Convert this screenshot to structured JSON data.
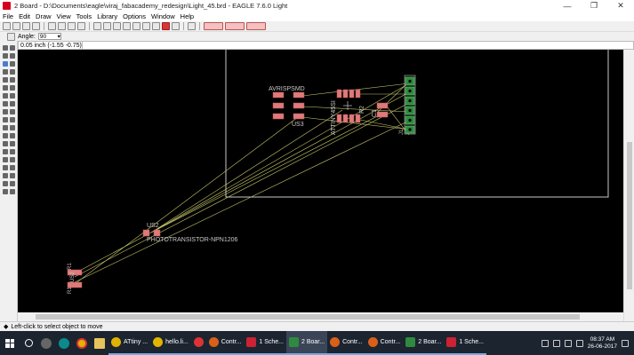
{
  "window": {
    "title": "2 Board - D:\\Documents\\eagle\\viraj_fabacademy_redesign\\Light_45.brd - EAGLE 7.6.0 Light",
    "minimize": "—",
    "maximize": "❐",
    "close": "✕"
  },
  "menu": {
    "items": [
      "File",
      "Edit",
      "Draw",
      "View",
      "Tools",
      "Library",
      "Options",
      "Window",
      "Help"
    ]
  },
  "params": {
    "angle_label": "Angle:",
    "angle_value": "90"
  },
  "coord": {
    "readout": "0.05 inch (-1.55 -0.75)"
  },
  "board": {
    "labels": {
      "avrispsmd": "AVRISPSMD",
      "us3": "US3",
      "attiny": "ATTINY45SI",
      "us2_top": "US2",
      "us2": "US2",
      "phototransistor": "PHOTOTRANSISTOR-NPN1206",
      "r1_top": "R1",
      "r1_bottom": "R1",
      "c1": "C1",
      "j1": "J1",
      "r2": "R2"
    },
    "colors": {
      "background": "#000000",
      "outline": "#c8c8c8",
      "airwire": "#c9c86a",
      "pad": "#e07a7a",
      "connector": "#2e8b3e",
      "text": "#c8c8c8"
    }
  },
  "status": {
    "text": "Left-click to select object to move"
  },
  "taskbar": {
    "items": [
      {
        "label": "ATtiny ...",
        "icon": "chrome-icon"
      },
      {
        "label": "hello.li...",
        "icon": "chrome-icon"
      },
      {
        "label": "",
        "icon": "eagle-icon"
      },
      {
        "label": "Contr...",
        "icon": "eagle-icon"
      },
      {
        "label": "1 Sche...",
        "icon": "schematic-icon"
      },
      {
        "label": "2 Boar...",
        "icon": "board-icon"
      },
      {
        "label": "Contr...",
        "icon": "eagle-icon"
      },
      {
        "label": "Contr...",
        "icon": "eagle-icon"
      },
      {
        "label": "2 Boar...",
        "icon": "board-icon"
      },
      {
        "label": "1 Sche...",
        "icon": "schematic-icon"
      }
    ],
    "time": "08:37 AM",
    "date": "26-06-2017",
    "colors": {
      "background": "#1c2430",
      "accent": "#7aa7e0"
    }
  }
}
